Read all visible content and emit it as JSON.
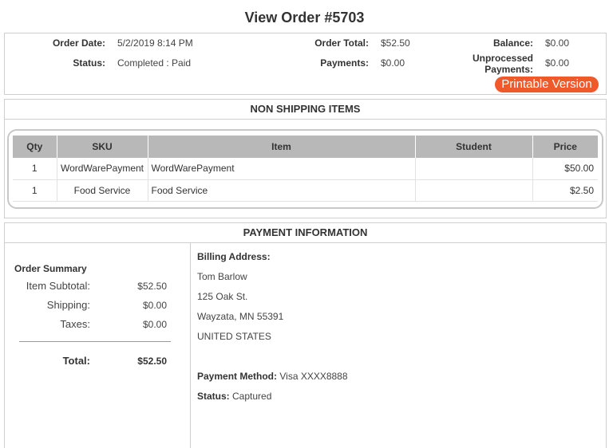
{
  "page": {
    "title": "View Order #5703"
  },
  "summary": {
    "order_date_label": "Order Date:",
    "order_date": "5/2/2019 8:14 PM",
    "status_label": "Status:",
    "status": "Completed : Paid",
    "order_total_label": "Order Total:",
    "order_total": "$52.50",
    "payments_label": "Payments:",
    "payments": "$0.00",
    "balance_label": "Balance:",
    "balance": "$0.00",
    "unprocessed_label_1": "Unprocessed",
    "unprocessed_label_2": "Payments:",
    "unprocessed": "$0.00",
    "printable_label": "Printable Version"
  },
  "items": {
    "header": "NON SHIPPING ITEMS",
    "columns": [
      "Qty",
      "SKU",
      "Item",
      "Student",
      "Price"
    ],
    "rows": [
      {
        "qty": "1",
        "sku": "WordWarePayment",
        "item": "WordWarePayment",
        "student": "",
        "price": "$50.00"
      },
      {
        "qty": "1",
        "sku": "Food Service",
        "item": "Food Service",
        "student": "",
        "price": "$2.50"
      }
    ]
  },
  "payment": {
    "header": "PAYMENT INFORMATION",
    "order_summary": {
      "title": "Order Summary",
      "subtotal_label": "Item Subtotal:",
      "subtotal": "$52.50",
      "shipping_label": "Shipping:",
      "shipping": "$0.00",
      "taxes_label": "Taxes:",
      "taxes": "$0.00",
      "total_label": "Total:",
      "total": "$52.50"
    },
    "billing": {
      "label": "Billing Address:",
      "name": "Tom Barlow",
      "street": "125 Oak St.",
      "city": "Wayzata, MN 55391",
      "country": "UNITED STATES",
      "method_label": "Payment Method:",
      "method": "Visa XXXX8888",
      "status_label": "Status:",
      "status": "Captured"
    }
  }
}
